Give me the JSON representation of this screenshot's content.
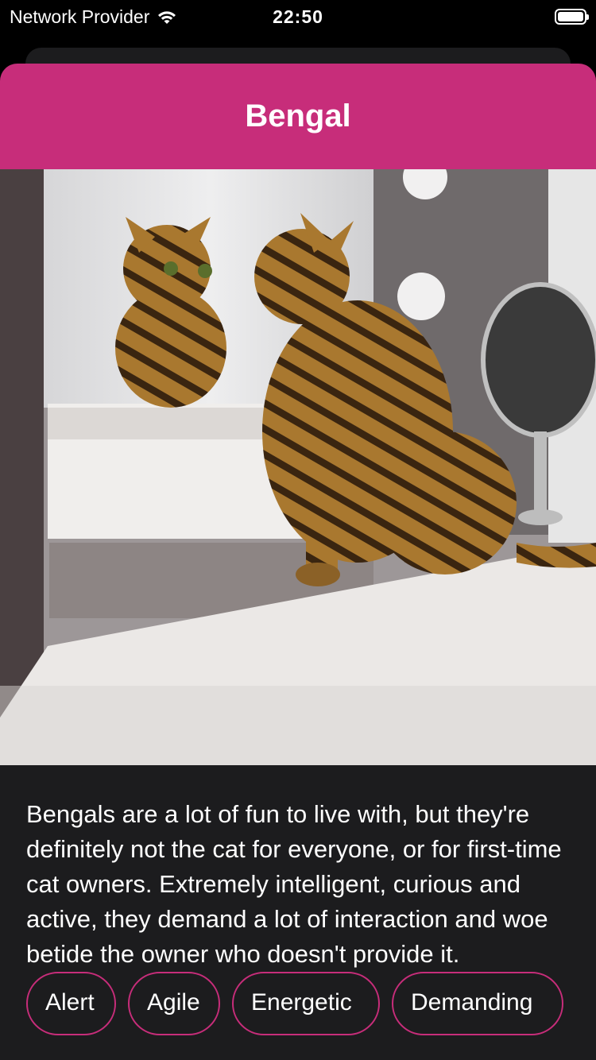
{
  "status_bar": {
    "carrier": "Network Provider",
    "time": "22:50",
    "wifi_icon": "wifi-icon",
    "battery_icon": "battery-full-icon"
  },
  "sheet": {
    "title": "Bengal",
    "header_color": "#c72d7a",
    "background_color": "#1c1c1e",
    "photo_icon": "cat-photo-image",
    "description": "Bengals are a lot of fun to live with, but they're definitely not the cat for everyone, or for first-time cat owners. Extremely intelligent, curious and active, they demand a lot of interaction and woe betide the owner who doesn't provide it."
  },
  "tags": [
    {
      "label": "Alert"
    },
    {
      "label": "Agile"
    },
    {
      "label": "Energetic"
    },
    {
      "label": "Demanding"
    }
  ]
}
